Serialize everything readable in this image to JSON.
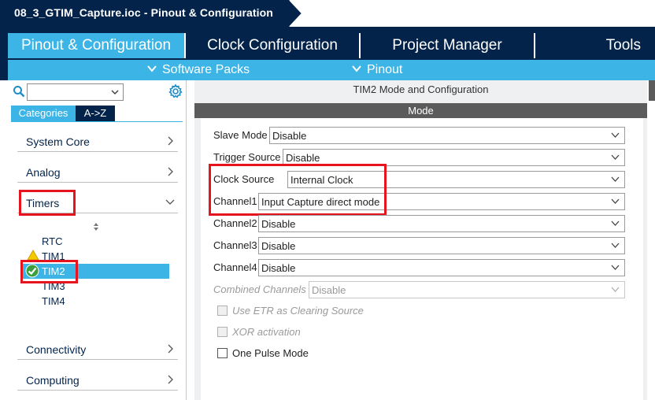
{
  "title": "08_3_GTIM_Capture.ioc - Pinout & Configuration",
  "nav": {
    "tabs": [
      "Pinout & Configuration",
      "Clock Configuration",
      "Project Manager",
      "Tools"
    ],
    "active_tab": "Pinout & Configuration",
    "sub_items": [
      "Software Packs",
      "Pinout"
    ]
  },
  "left_panel": {
    "search": {
      "value": "",
      "icon": "search-icon"
    },
    "settings_icon": "gear-icon",
    "view_tabs": [
      "Categories",
      "A->Z"
    ],
    "active_view_tab": "Categories",
    "categories_top": [
      "System Core",
      "Analog",
      "Timers"
    ],
    "timers": [
      "RTC",
      "TIM1",
      "TIM2",
      "TIM3",
      "TIM4"
    ],
    "selected_timer": "TIM2",
    "categories_bottom": [
      "Connectivity",
      "Computing"
    ]
  },
  "config": {
    "title": "TIM2 Mode and Configuration",
    "section": "Mode",
    "fields": [
      {
        "label": "Slave Mode",
        "value": "Disable",
        "enabled": true
      },
      {
        "label": "Trigger Source",
        "value": "Disable",
        "enabled": true
      },
      {
        "label": "Clock Source",
        "value": "Internal Clock",
        "enabled": true
      },
      {
        "label": "Channel1",
        "value": "Input Capture direct mode",
        "enabled": true
      },
      {
        "label": "Channel2",
        "value": "Disable",
        "enabled": true
      },
      {
        "label": "Channel3",
        "value": "Disable",
        "enabled": true
      },
      {
        "label": "Channel4",
        "value": "Disable",
        "enabled": true
      },
      {
        "label": "Combined Channels",
        "value": "Disable",
        "enabled": false
      }
    ],
    "checkboxes": [
      {
        "label": "Use ETR as Clearing Source",
        "checked": false,
        "enabled": false
      },
      {
        "label": "XOR activation",
        "checked": false,
        "enabled": false
      },
      {
        "label": "One Pulse Mode",
        "checked": false,
        "enabled": true
      }
    ]
  },
  "colors": {
    "navy": "#03234b",
    "accent": "#3cb4e6",
    "highlight_red": "#e6141e",
    "ok_green": "#3ca03c",
    "warn_yellow": "#f5c800"
  }
}
